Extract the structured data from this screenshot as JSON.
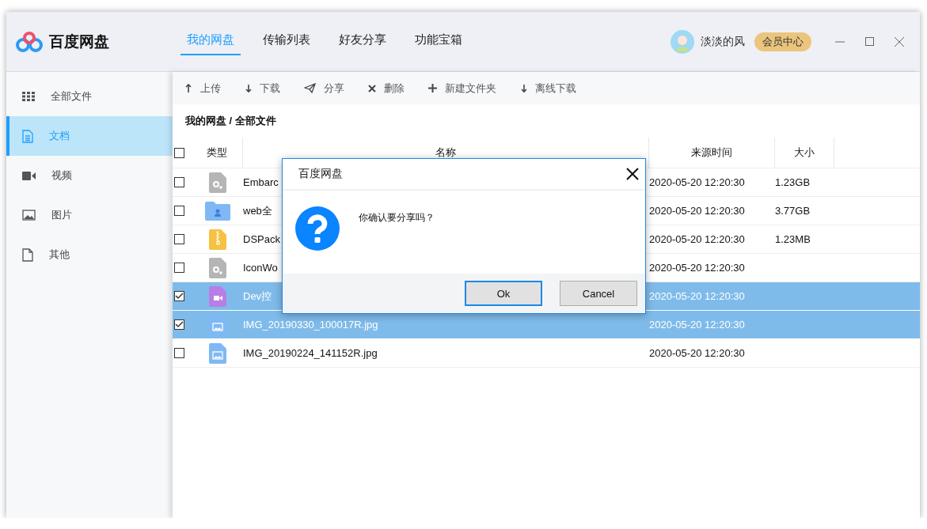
{
  "app": {
    "title": "百度网盘"
  },
  "nav_tabs": [
    {
      "label": "我的网盘",
      "selected": true
    },
    {
      "label": "传输列表",
      "selected": false
    },
    {
      "label": "好友分享",
      "selected": false
    },
    {
      "label": "功能宝箱",
      "selected": false
    }
  ],
  "user": {
    "name": "淡淡的风",
    "badge": "会员中心"
  },
  "sidebar": {
    "items": [
      {
        "label": "全部文件",
        "kind": "grid",
        "selected": false
      },
      {
        "label": "文档",
        "kind": "doc",
        "selected": true
      },
      {
        "label": "视频",
        "kind": "video",
        "selected": false
      },
      {
        "label": "图片",
        "kind": "image",
        "selected": false
      },
      {
        "label": "其他",
        "kind": "file",
        "selected": false
      }
    ]
  },
  "toolbar": [
    {
      "label": "上传",
      "kind": "upload"
    },
    {
      "label": "下载",
      "kind": "download"
    },
    {
      "label": "分享",
      "kind": "share"
    },
    {
      "label": "删除",
      "kind": "delete"
    },
    {
      "label": "新建文件夹",
      "kind": "new"
    },
    {
      "label": "离线下载",
      "kind": "download"
    }
  ],
  "breadcrumb": "我的网盘 / 全部文件",
  "table": {
    "columns": [
      "类型",
      "名称",
      "来源时间",
      "大小"
    ],
    "all_checked": false,
    "rows": [
      {
        "kind": "exe",
        "name": "Embarc",
        "time": "2020-05-20 12:20:30",
        "size": "1.23GB",
        "checked": false
      },
      {
        "kind": "folder",
        "name": "web全",
        "time": "2020-05-20 12:20:30",
        "size": "3.77GB",
        "checked": false
      },
      {
        "kind": "zip",
        "name": "DSPack",
        "time": "2020-05-20 12:20:30",
        "size": "1.23MB",
        "checked": false
      },
      {
        "kind": "exe",
        "name": "IconWo",
        "time": "2020-05-20 12:20:30",
        "checked": false
      },
      {
        "kind": "video",
        "name": "Dev控",
        "time": "2020-05-20 12:20:30",
        "checked": true
      },
      {
        "kind": "image",
        "name": "IMG_20190330_100017R.jpg",
        "time": "2020-05-20 12:20:30",
        "checked": true
      },
      {
        "kind": "image",
        "name": "IMG_20190224_141152R.jpg",
        "time": "2020-05-20 12:20:30",
        "checked": false
      }
    ]
  },
  "dialog": {
    "title": "百度网盘",
    "message": "你确认要分享吗？",
    "buttons": [
      {
        "label": "Ok",
        "selected": true
      },
      {
        "label": "Cancel",
        "selected": false
      }
    ]
  }
}
